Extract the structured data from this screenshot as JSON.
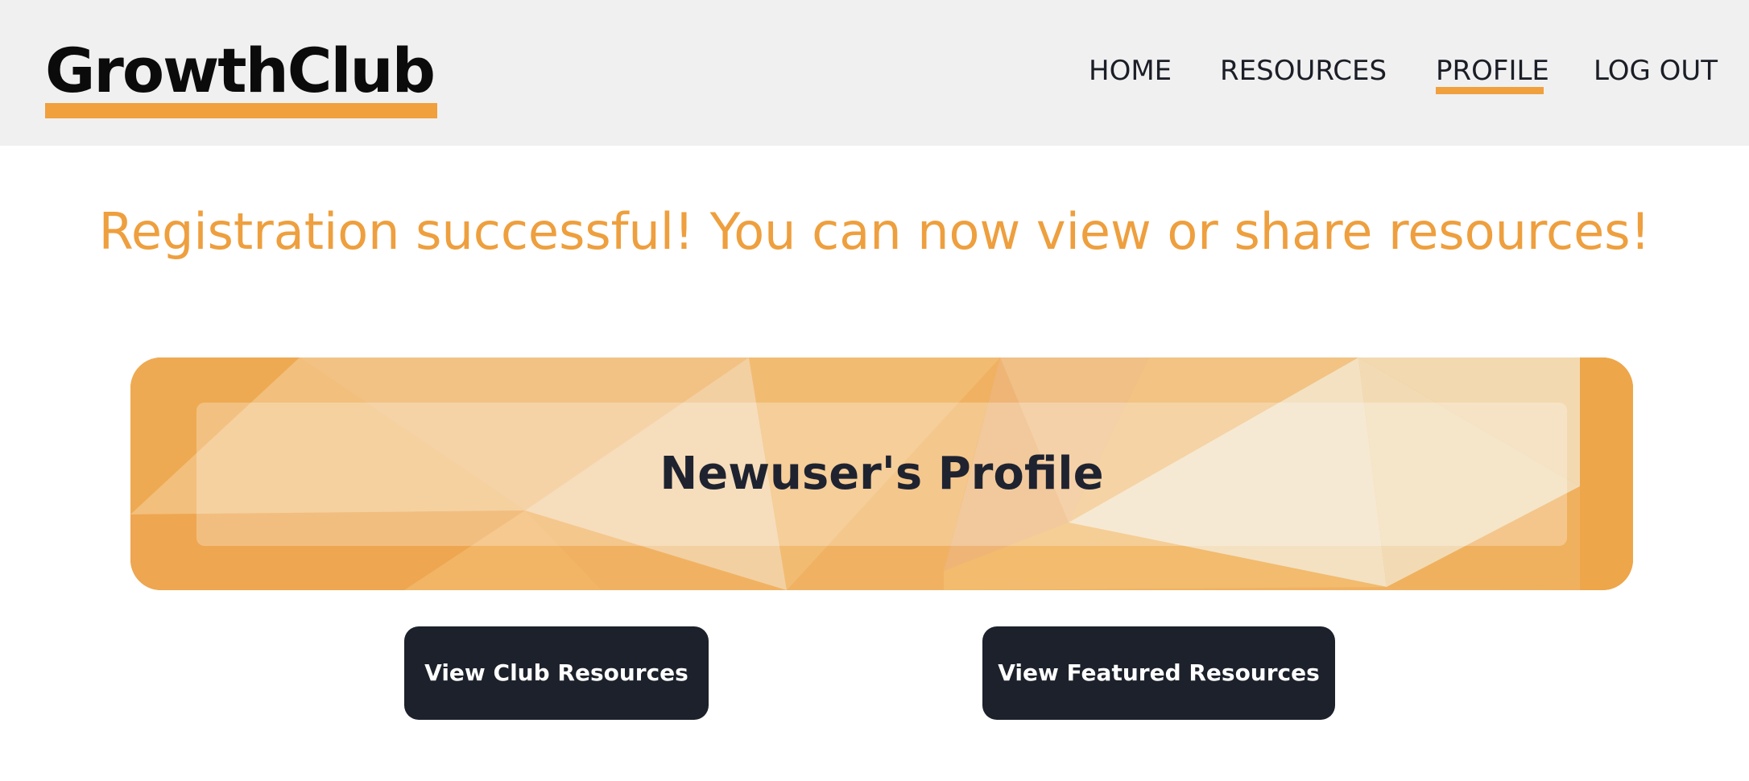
{
  "header": {
    "logo": "GrowthClub",
    "nav": [
      {
        "label": "HOME"
      },
      {
        "label": "RESOURCES"
      },
      {
        "label": "PROFILE",
        "active": true
      },
      {
        "label": "LOG OUT"
      }
    ]
  },
  "main": {
    "message": "Registration successful! You can now view or share resources!",
    "profile_title": "Newuser's Profile",
    "buttons": {
      "club_resources": "View Club Resources",
      "featured_resources": "View Featured Resources"
    }
  },
  "colors": {
    "accent": "#f0a03c",
    "nav_bg": "#f0f0f1",
    "button_bg": "#1c212b",
    "text_dark": "#1b1e26"
  }
}
